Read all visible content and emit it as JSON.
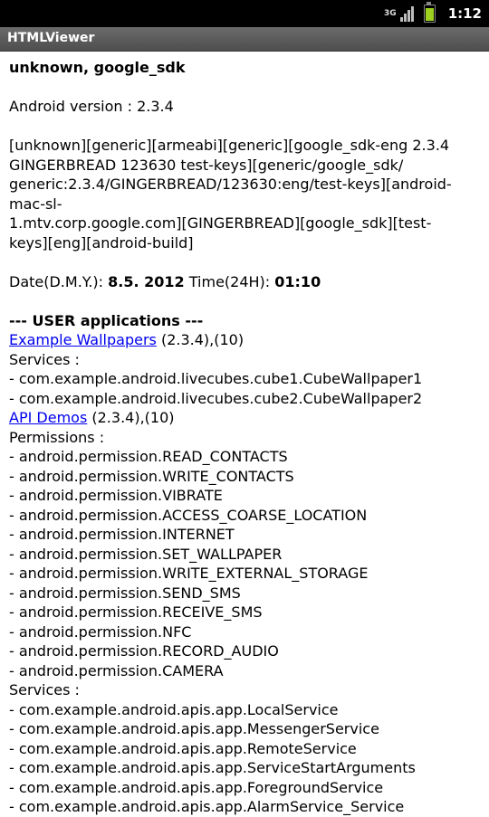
{
  "status_bar": {
    "network": "3G",
    "time": "1:12"
  },
  "app": {
    "title": "HTMLViewer"
  },
  "device": {
    "heading": "unknown, google_sdk",
    "android_version": "Android version : 2.3.4",
    "build_lines": [
      "[unknown][generic][armeabi][generic][google_sdk-eng 2.3.4",
      "GINGERBREAD 123630 test-keys][generic/google_sdk/",
      "generic:2.3.4/GINGERBREAD/123630:eng/test-keys][android-",
      "mac-sl-",
      "1.mtv.corp.google.com][GINGERBREAD][google_sdk][test-",
      "keys][eng][android-build]"
    ],
    "date_label": "Date(D.M.Y.):",
    "date_value": "8.5. 2012",
    "time_label": "Time(24H):",
    "time_value": "01:10"
  },
  "user_apps": {
    "heading": "--- USER applications ---",
    "app1": {
      "name": "Example Wallpapers",
      "version": "(2.3.4),(10)",
      "services_label": "Services :",
      "services": [
        "- com.example.android.livecubes.cube1.CubeWallpaper1",
        "- com.example.android.livecubes.cube2.CubeWallpaper2"
      ]
    },
    "app2": {
      "name": "API Demos",
      "version": "(2.3.4),(10)",
      "permissions_label": "Permissions :",
      "permissions": [
        "- android.permission.READ_CONTACTS",
        "- android.permission.WRITE_CONTACTS",
        "- android.permission.VIBRATE",
        "- android.permission.ACCESS_COARSE_LOCATION",
        "- android.permission.INTERNET",
        "- android.permission.SET_WALLPAPER",
        "- android.permission.WRITE_EXTERNAL_STORAGE",
        "- android.permission.SEND_SMS",
        "- android.permission.RECEIVE_SMS",
        "- android.permission.NFC",
        "- android.permission.RECORD_AUDIO",
        "- android.permission.CAMERA"
      ],
      "services_label": "Services :",
      "services": [
        "- com.example.android.apis.app.LocalService",
        "- com.example.android.apis.app.MessengerService",
        "- com.example.android.apis.app.RemoteService",
        "- com.example.android.apis.app.ServiceStartArguments",
        "- com.example.android.apis.app.ForegroundService",
        "- com.example.android.apis.app.AlarmService_Service"
      ]
    }
  }
}
